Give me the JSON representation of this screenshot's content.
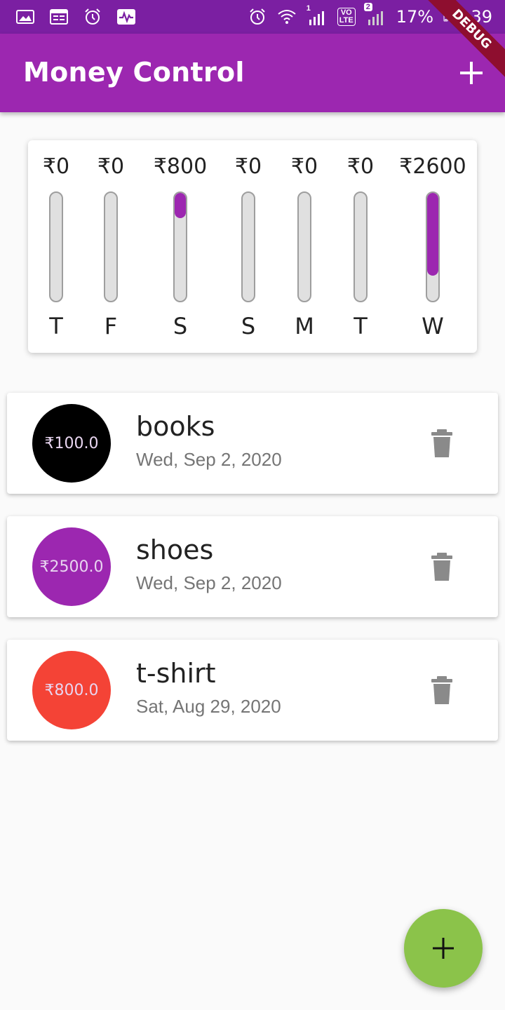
{
  "status_bar": {
    "battery": "17%",
    "time": "4:39",
    "sim1_label": "1",
    "sim2_badge": "2",
    "volte_label": "VO\nLTE"
  },
  "app_bar": {
    "title": "Money Control",
    "debug_label": "DEBUG"
  },
  "chart": {
    "bars": [
      {
        "amount": "₹0",
        "day": "T",
        "fraction": 0
      },
      {
        "amount": "₹0",
        "day": "F",
        "fraction": 0
      },
      {
        "amount": "₹800",
        "day": "S",
        "fraction": 0.235
      },
      {
        "amount": "₹0",
        "day": "S",
        "fraction": 0
      },
      {
        "amount": "₹0",
        "day": "M",
        "fraction": 0
      },
      {
        "amount": "₹0",
        "day": "T",
        "fraction": 0
      },
      {
        "amount": "₹2600",
        "day": "W",
        "fraction": 0.765
      }
    ]
  },
  "transactions": [
    {
      "amount": "₹100.0",
      "title": "books",
      "date": "Wed, Sep 2, 2020",
      "color": "#000000"
    },
    {
      "amount": "₹2500.0",
      "title": "shoes",
      "date": "Wed, Sep 2, 2020",
      "color": "#9c27b0"
    },
    {
      "amount": "₹800.0",
      "title": "t-shirt",
      "date": "Sat, Aug 29, 2020",
      "color": "#f44336"
    }
  ],
  "colors": {
    "primary": "#9c27b0",
    "status_bar": "#7b1fa2",
    "fab": "#8bc34a"
  },
  "icons": {
    "app_bar_action": "plus-icon",
    "delete": "trash-icon",
    "fab": "plus-icon"
  }
}
